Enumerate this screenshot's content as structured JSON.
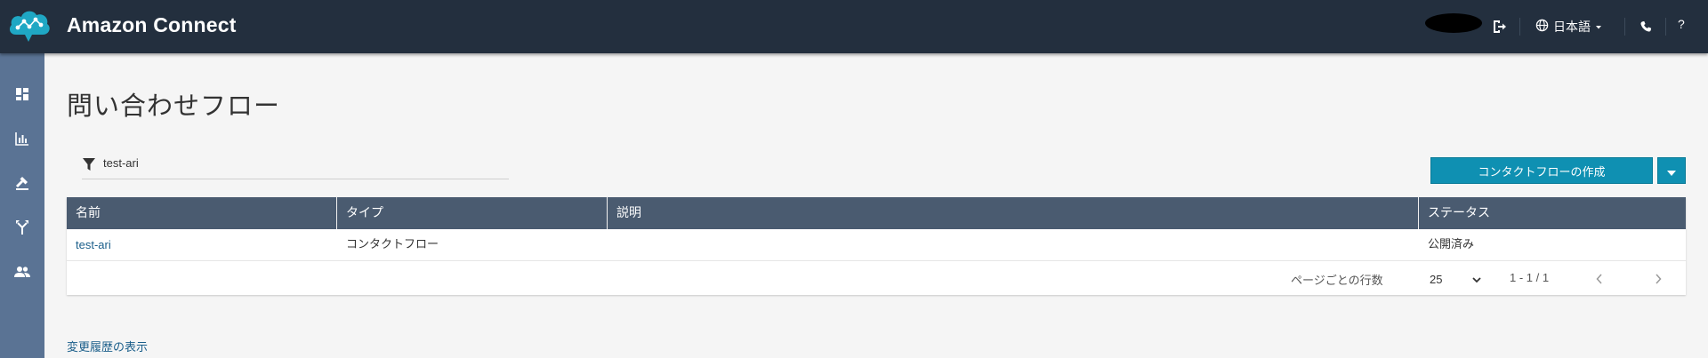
{
  "header": {
    "app_title": "Amazon Connect",
    "language_label": "日本語",
    "help_label": "?",
    "logo_icon": "cloud-network-icon",
    "bg_color": "#232f3e"
  },
  "sidebar": {
    "items": [
      {
        "name": "dashboard",
        "icon": "dashboard-icon"
      },
      {
        "name": "metrics",
        "icon": "bar-chart-icon"
      },
      {
        "name": "routing",
        "icon": "routing-icon"
      },
      {
        "name": "channels",
        "icon": "fork-icon"
      },
      {
        "name": "users",
        "icon": "users-icon"
      }
    ],
    "bg_color": "#5a7394"
  },
  "main": {
    "title": "問い合わせフロー",
    "filter": {
      "value": "test-ari",
      "icon": "filter-icon"
    },
    "create_button_label": "コンタクトフローの作成",
    "accent_color": "#0f90b2",
    "table": {
      "columns": [
        "名前",
        "タイプ",
        "説明",
        "ステータス"
      ],
      "rows": [
        {
          "name": "test-ari",
          "type": "コンタクトフロー",
          "description": "",
          "status": "公開済み"
        }
      ],
      "header_color": "#4a5b70"
    },
    "pagination": {
      "rows_per_page_label": "ページごとの行数",
      "rows_per_page_value": "25",
      "range": "1 - 1 / 1"
    },
    "history_link": "変更履歴の表示"
  }
}
